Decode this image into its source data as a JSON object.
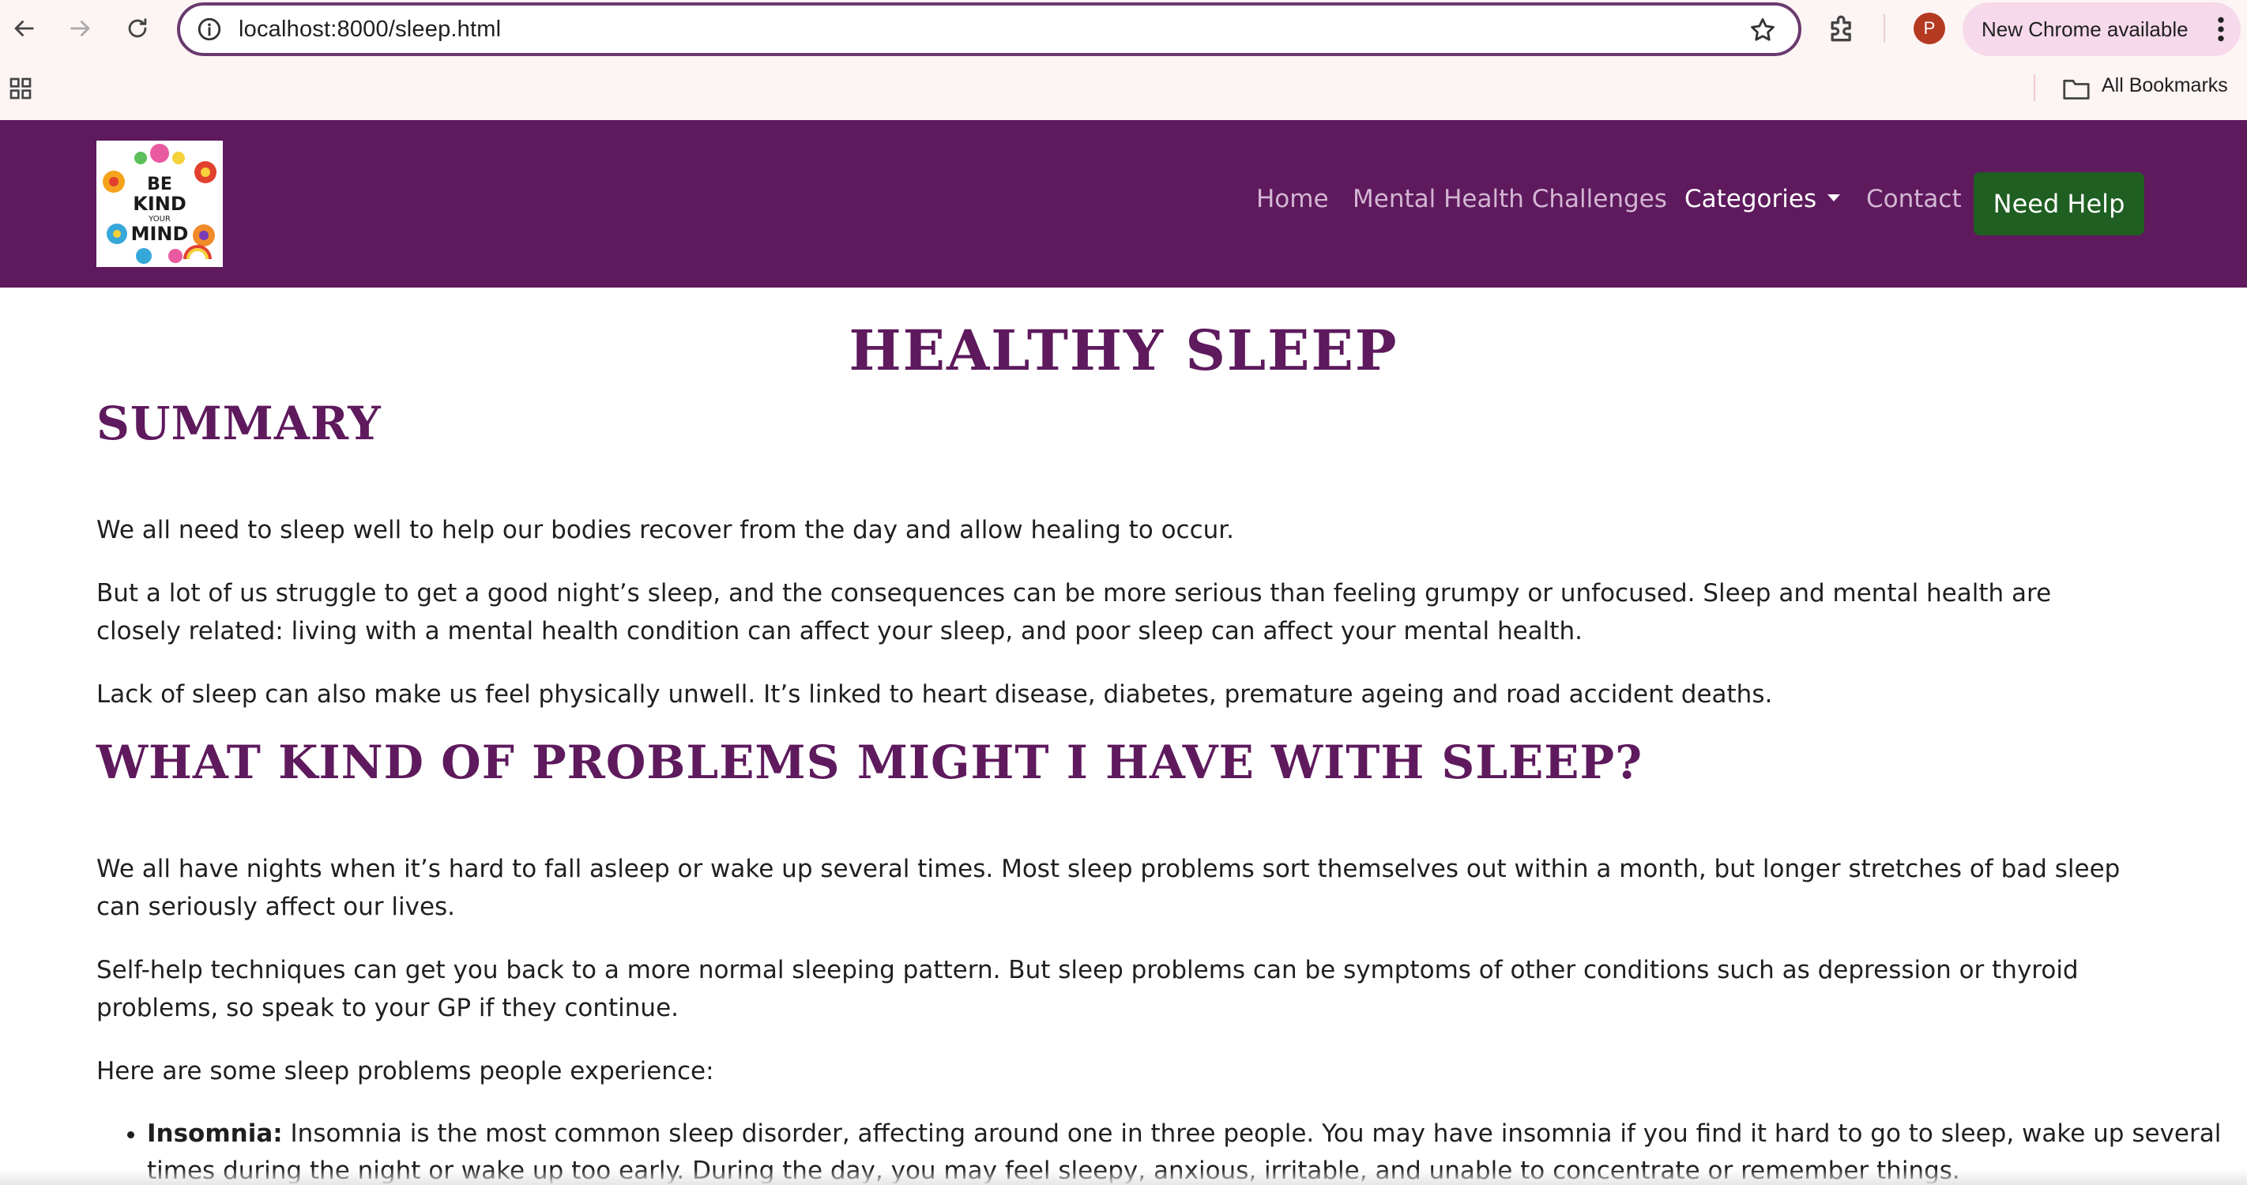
{
  "browser": {
    "url": "localhost:8000/sleep.html",
    "update_label": "New Chrome available",
    "avatar_letter": "P",
    "bookmarks_label": "All Bookmarks"
  },
  "site": {
    "logo_alt": "Be kind to your mind",
    "nav": {
      "home": "Home",
      "challenges": "Mental Health Challenges",
      "categories": "Categories",
      "contact": "Contact",
      "need_help": "Need Help"
    },
    "colors": {
      "header_bg": "#5e1a5d",
      "accent": "#5e1a5d",
      "help_button": "#1f5f22"
    }
  },
  "page": {
    "title": "HEALTHY SLEEP",
    "summary_heading": "SUMMARY",
    "summary_paragraphs": [
      "We all need to sleep well to help our bodies recover from the day and allow healing to occur.",
      "But a lot of us struggle to get a good night’s sleep, and the consequences can be more serious than feeling grumpy or unfocused. Sleep and mental health are closely related: living with a mental health condition can affect your sleep, and poor sleep can affect your mental health.",
      "Lack of sleep can also make us feel physically unwell. It’s linked to heart disease, diabetes, premature ageing and road accident deaths."
    ],
    "problems_heading": "WHAT KIND OF PROBLEMS MIGHT I HAVE WITH SLEEP?",
    "problems_paragraphs": [
      "We all have nights when it’s hard to fall asleep or wake up several times. Most sleep problems sort themselves out within a month, but longer stretches of bad sleep can seriously affect our lives.",
      "Self-help techniques can get you back to a more normal sleeping pattern. But sleep problems can be symptoms of other conditions such as depression or thyroid problems, so speak to your GP if they continue.",
      "Here are some sleep problems people experience:"
    ],
    "problems_list": [
      {
        "term": "Insomnia:",
        "text": "Insomnia is the most common sleep disorder, affecting around one in three people. You may have insomnia if you find it hard to go to sleep, wake up several times during the night or wake up too early. During the day, you may feel sleepy, anxious, irritable, and unable to concentrate or remember things."
      }
    ]
  }
}
